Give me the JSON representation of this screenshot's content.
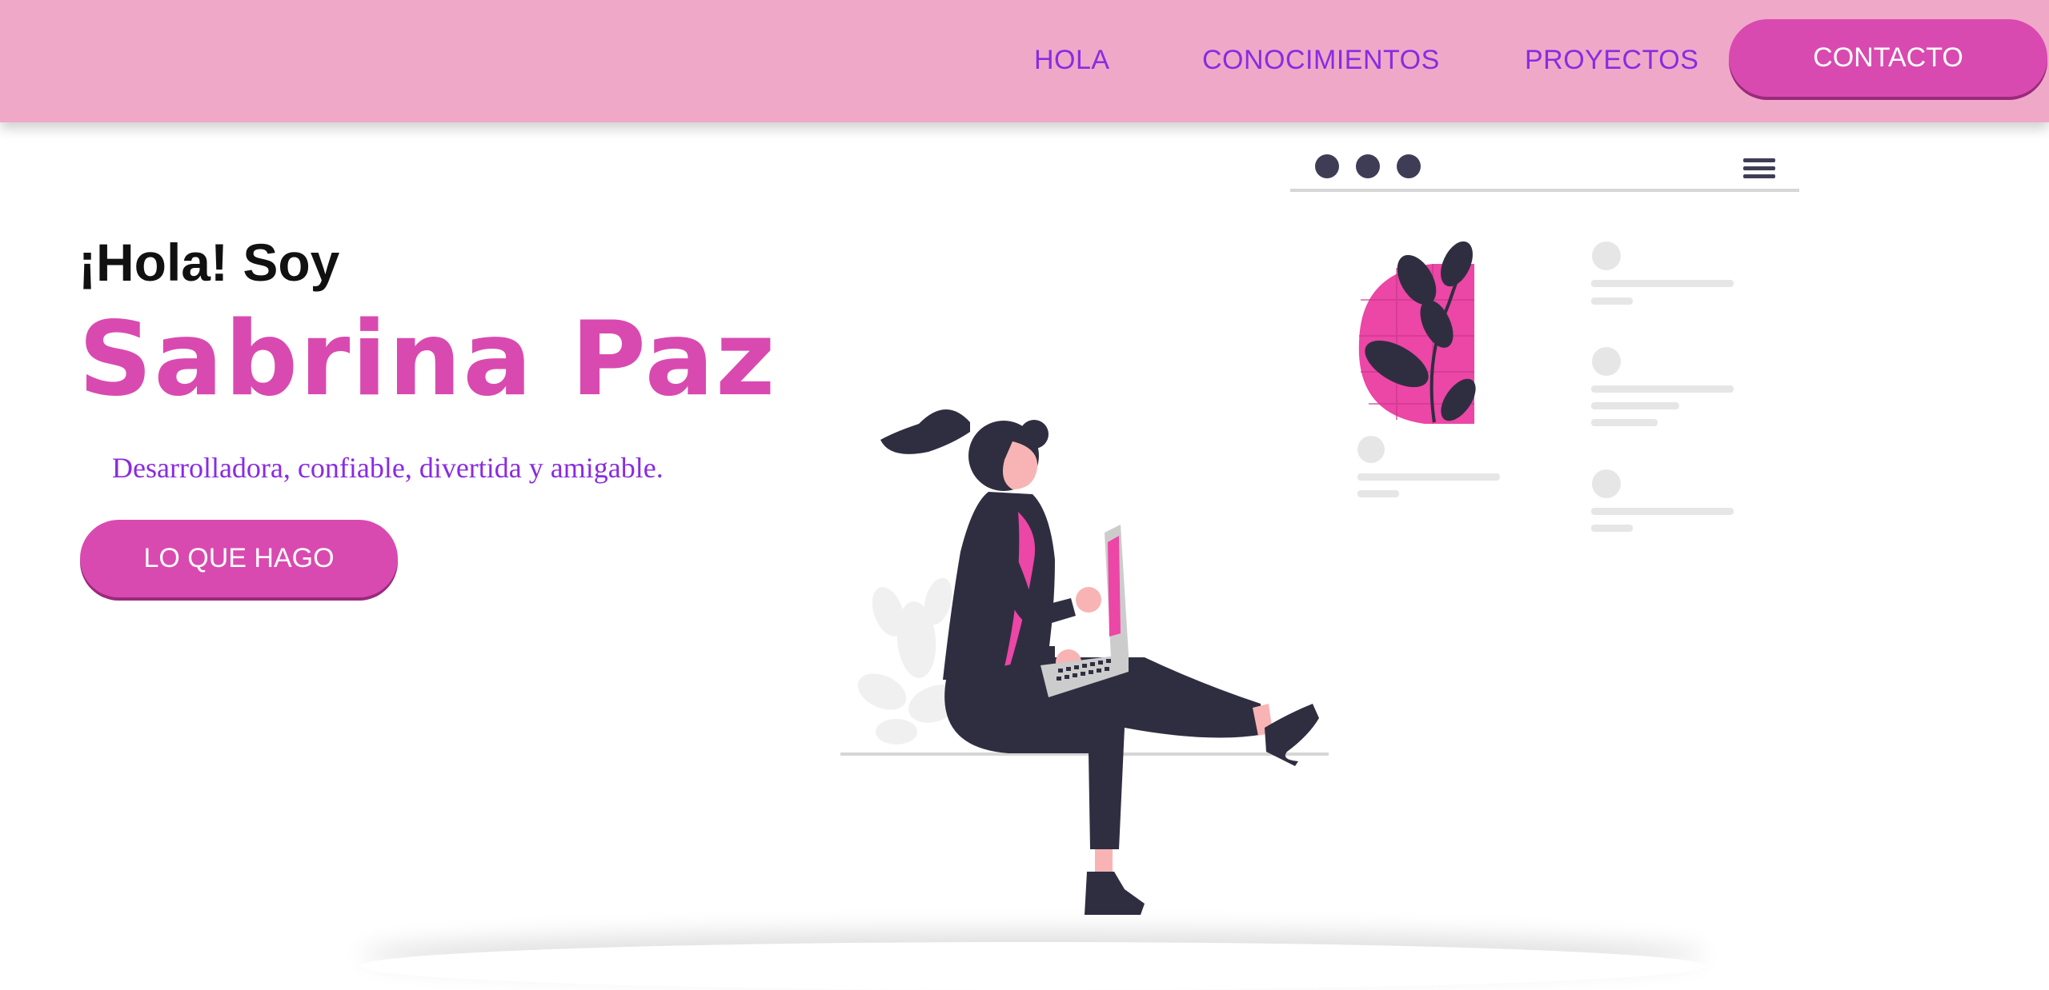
{
  "nav": {
    "items": [
      {
        "label": "HOLA"
      },
      {
        "label": "CONOCIMIENTOS"
      },
      {
        "label": "PROYECTOS"
      }
    ],
    "contact_label": "CONTACTO"
  },
  "hero": {
    "greeting": "¡Hola! Soy",
    "name": "Sabrina Paz",
    "tagline": "Desarrolladora, confiable, divertida y amigable.",
    "cta_label": "LO QUE HAGO"
  },
  "colors": {
    "navbar": "#f0a8c8",
    "accent": "#d94ab0",
    "link": "#8a2be2",
    "dark": "#2f2e41"
  },
  "icons": [
    "menu-icon",
    "window-dots-icon"
  ]
}
